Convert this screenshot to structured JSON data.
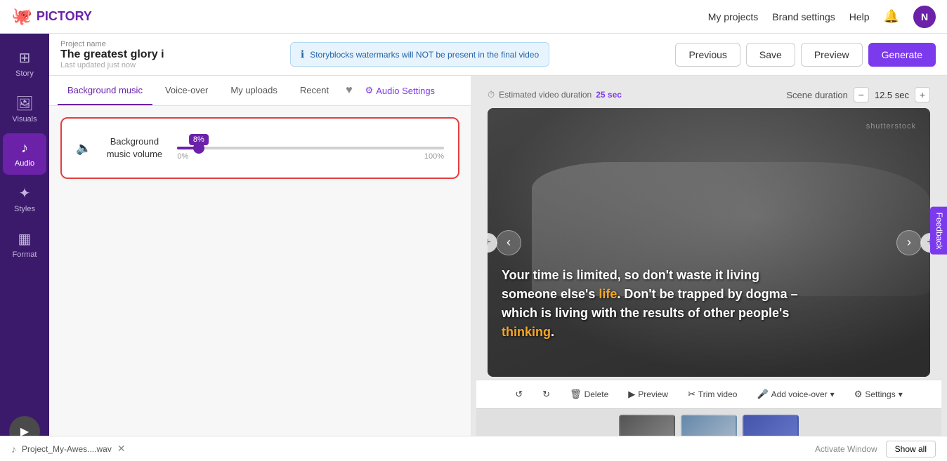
{
  "logo": {
    "icon": "🐙",
    "name": "PICTORY"
  },
  "topnav": {
    "links": [
      "My projects",
      "Brand settings",
      "Help"
    ],
    "notification_icon": "🔔",
    "avatar_initial": "N"
  },
  "project": {
    "name_label": "Project name",
    "title": "The greatest glory i",
    "updated": "Last updated just now",
    "notice": "Storyblocks watermarks will NOT be present in the final video"
  },
  "header_buttons": {
    "previous": "Previous",
    "save": "Save",
    "preview": "Preview",
    "generate": "Generate"
  },
  "estimated_duration": {
    "label": "Estimated video duration",
    "value": "25 sec"
  },
  "sidebar": {
    "items": [
      {
        "id": "story",
        "icon": "⊞",
        "label": "Story"
      },
      {
        "id": "visuals",
        "icon": "🖼",
        "label": "Visuals"
      },
      {
        "id": "audio",
        "icon": "🎵",
        "label": "Audio"
      },
      {
        "id": "styles",
        "icon": "✦",
        "label": "Styles"
      },
      {
        "id": "format",
        "icon": "⊡",
        "label": "Format"
      }
    ],
    "play_icon": "▶"
  },
  "audio_tabs": {
    "tabs": [
      "Background music",
      "Voice-over",
      "My uploads",
      "Recent"
    ],
    "heart": "♥",
    "settings_label": "Audio Settings"
  },
  "volume_control": {
    "label": "Background\nmusic volume",
    "volume_icon": "🔈",
    "value": 8,
    "min_label": "0%",
    "max_label": "100%",
    "tooltip": "8%"
  },
  "scene_controls": {
    "label": "Scene duration",
    "value": "12.5 sec",
    "decrease_icon": "−",
    "increase_icon": "+"
  },
  "video": {
    "text_line1": "Your time is limited, so don't waste it living",
    "text_line2_pre": "someone else's ",
    "text_life": "life",
    "text_line2_post": ". Don't be trapped by dogma –",
    "text_line3": "which is living with the results of other people's",
    "text_thinking": "thinking",
    "text_end": ".",
    "watermark": "shutterstock",
    "nav_left": "‹",
    "nav_right": "›",
    "add_left": "+",
    "add_right": "+"
  },
  "video_toolbar": {
    "buttons": [
      {
        "id": "undo",
        "icon": "↺",
        "label": ""
      },
      {
        "id": "redo",
        "icon": "↻",
        "label": ""
      },
      {
        "id": "delete",
        "icon": "🗑",
        "label": "Delete"
      },
      {
        "id": "preview",
        "icon": "▶",
        "label": "Preview"
      },
      {
        "id": "trim",
        "icon": "✂",
        "label": "Trim video"
      },
      {
        "id": "voiceover",
        "icon": "🎤",
        "label": "Add voice-over"
      },
      {
        "id": "settings",
        "icon": "⚙",
        "label": "Settings"
      }
    ]
  },
  "thumbnails": [
    {
      "id": "thumb1",
      "type": "car",
      "active": false
    },
    {
      "id": "thumb2",
      "type": "road",
      "active": false
    },
    {
      "id": "thumb3",
      "type": "purple",
      "active": false
    }
  ],
  "bottom_bar": {
    "audio_file": "Project_My-Awes....wav",
    "close_icon": "✕",
    "activate_windows": "Activate Window",
    "show_all": "Show all"
  },
  "feedback_tab": "Feedback"
}
